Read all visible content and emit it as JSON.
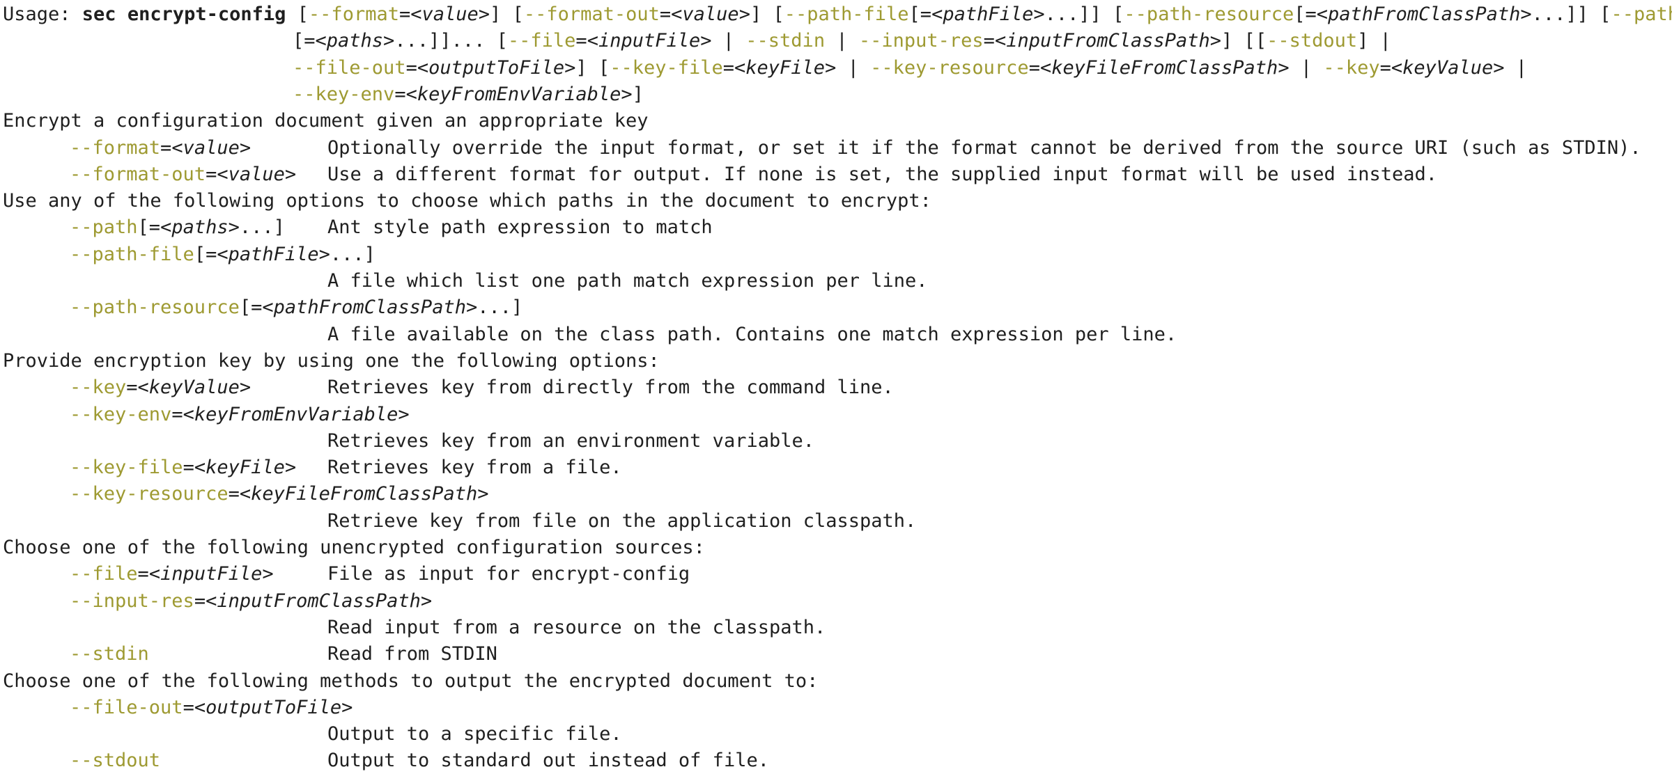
{
  "usage": {
    "prefix": "Usage: ",
    "command": "sec encrypt-config",
    "line1": [
      {
        "t": " [",
        "k": "p"
      },
      {
        "t": "--format",
        "k": "o"
      },
      {
        "t": "=",
        "k": "p"
      },
      {
        "t": "<value>",
        "k": "i"
      },
      {
        "t": "] [",
        "k": "p"
      },
      {
        "t": "--format-out",
        "k": "o"
      },
      {
        "t": "=",
        "k": "p"
      },
      {
        "t": "<value>",
        "k": "i"
      },
      {
        "t": "] [",
        "k": "p"
      },
      {
        "t": "--path-file",
        "k": "o"
      },
      {
        "t": "[=",
        "k": "p"
      },
      {
        "t": "<pathFile>",
        "k": "i"
      },
      {
        "t": "...]] [",
        "k": "p"
      },
      {
        "t": "--path-resource",
        "k": "o"
      },
      {
        "t": "[=",
        "k": "p"
      },
      {
        "t": "<pathFromClassPath>",
        "k": "i"
      },
      {
        "t": "...]] [",
        "k": "p"
      },
      {
        "t": "--path",
        "k": "o"
      }
    ],
    "line2": [
      {
        "t": "[=",
        "k": "p"
      },
      {
        "t": "<paths>",
        "k": "i"
      },
      {
        "t": "...]]... [",
        "k": "p"
      },
      {
        "t": "--file",
        "k": "o"
      },
      {
        "t": "=",
        "k": "p"
      },
      {
        "t": "<inputFile>",
        "k": "i"
      },
      {
        "t": " | ",
        "k": "p"
      },
      {
        "t": "--stdin",
        "k": "o"
      },
      {
        "t": " | ",
        "k": "p"
      },
      {
        "t": "--input-res",
        "k": "o"
      },
      {
        "t": "=",
        "k": "p"
      },
      {
        "t": "<inputFromClassPath>",
        "k": "i"
      },
      {
        "t": "] [[",
        "k": "p"
      },
      {
        "t": "--stdout",
        "k": "o"
      },
      {
        "t": "] |",
        "k": "p"
      }
    ],
    "line3": [
      {
        "t": "--file-out",
        "k": "o"
      },
      {
        "t": "=",
        "k": "p"
      },
      {
        "t": "<outputToFile>",
        "k": "i"
      },
      {
        "t": "] [",
        "k": "p"
      },
      {
        "t": "--key-file",
        "k": "o"
      },
      {
        "t": "=",
        "k": "p"
      },
      {
        "t": "<keyFile>",
        "k": "i"
      },
      {
        "t": " | ",
        "k": "p"
      },
      {
        "t": "--key-resource",
        "k": "o"
      },
      {
        "t": "=",
        "k": "p"
      },
      {
        "t": "<keyFileFromClassPath>",
        "k": "i"
      },
      {
        "t": " | ",
        "k": "p"
      },
      {
        "t": "--key",
        "k": "o"
      },
      {
        "t": "=",
        "k": "p"
      },
      {
        "t": "<keyValue>",
        "k": "i"
      },
      {
        "t": " |",
        "k": "p"
      }
    ],
    "line4": [
      {
        "t": "--key-env",
        "k": "o"
      },
      {
        "t": "=",
        "k": "p"
      },
      {
        "t": "<keyFromEnvVariable>",
        "k": "i"
      },
      {
        "t": "]",
        "k": "p"
      }
    ]
  },
  "description": "Encrypt a configuration document given an appropriate key",
  "body": [
    {
      "type": "option",
      "opt": "--format",
      "sep": "=",
      "arg": "<value>",
      "tail": "",
      "desc": "Optionally override the input format, or set it if the format cannot be derived from the source URI (such as STDIN).",
      "wrap": false
    },
    {
      "type": "option",
      "opt": "--format-out",
      "sep": "=",
      "arg": "<value>",
      "tail": "",
      "desc": "Use a different format for output. If none is set, the supplied input format will be used instead.",
      "wrap": false
    },
    {
      "type": "heading",
      "text": "Use any of the following options to choose which paths in the document to encrypt:"
    },
    {
      "type": "option",
      "opt": "--path",
      "sep": "[=",
      "arg": "<paths>",
      "tail": "...]",
      "desc": "Ant style path expression to match",
      "wrap": false
    },
    {
      "type": "option",
      "opt": "--path-file",
      "sep": "[=",
      "arg": "<pathFile>",
      "tail": "...]",
      "desc": "A file which list one path match expression per line.",
      "wrap": true
    },
    {
      "type": "option",
      "opt": "--path-resource",
      "sep": "[=",
      "arg": "<pathFromClassPath>",
      "tail": "...]",
      "desc": "A file available on the class path. Contains one match expression per line.",
      "wrap": true
    },
    {
      "type": "heading",
      "text": "Provide encryption key by using one the following options:"
    },
    {
      "type": "option",
      "opt": "--key",
      "sep": "=",
      "arg": "<keyValue>",
      "tail": "",
      "desc": "Retrieves key from directly from the command line.",
      "wrap": false
    },
    {
      "type": "option",
      "opt": "--key-env",
      "sep": "=",
      "arg": "<keyFromEnvVariable>",
      "tail": "",
      "desc": "Retrieves key from an environment variable.",
      "wrap": true
    },
    {
      "type": "option",
      "opt": "--key-file",
      "sep": "=",
      "arg": "<keyFile>",
      "tail": "",
      "desc": "Retrieves key from a file.",
      "wrap": false
    },
    {
      "type": "option",
      "opt": "--key-resource",
      "sep": "=",
      "arg": "<keyFileFromClassPath>",
      "tail": "",
      "desc": "Retrieve key from file on the application classpath.",
      "wrap": true
    },
    {
      "type": "heading",
      "text": "Choose one of the following unencrypted configuration sources:"
    },
    {
      "type": "option",
      "opt": "--file",
      "sep": "=",
      "arg": "<inputFile>",
      "tail": "",
      "desc": "File as input for encrypt-config",
      "wrap": false
    },
    {
      "type": "option",
      "opt": "--input-res",
      "sep": "=",
      "arg": "<inputFromClassPath>",
      "tail": "",
      "desc": "Read input from a resource on the classpath.",
      "wrap": true
    },
    {
      "type": "option",
      "opt": "--stdin",
      "sep": "",
      "arg": "",
      "tail": "",
      "desc": "Read from STDIN",
      "wrap": false
    },
    {
      "type": "heading",
      "text": "Choose one of the following methods to output the encrypted document to:"
    },
    {
      "type": "option",
      "opt": "--file-out",
      "sep": "=",
      "arg": "<outputToFile>",
      "tail": "",
      "desc": "Output to a specific file.",
      "wrap": true
    },
    {
      "type": "option",
      "opt": "--stdout",
      "sep": "",
      "arg": "",
      "tail": "",
      "desc": "Output to standard out instead of file.",
      "wrap": false
    }
  ],
  "colors": {
    "option": "#9e9a32",
    "text": "#1f1f1f",
    "background": "#ffffff"
  }
}
